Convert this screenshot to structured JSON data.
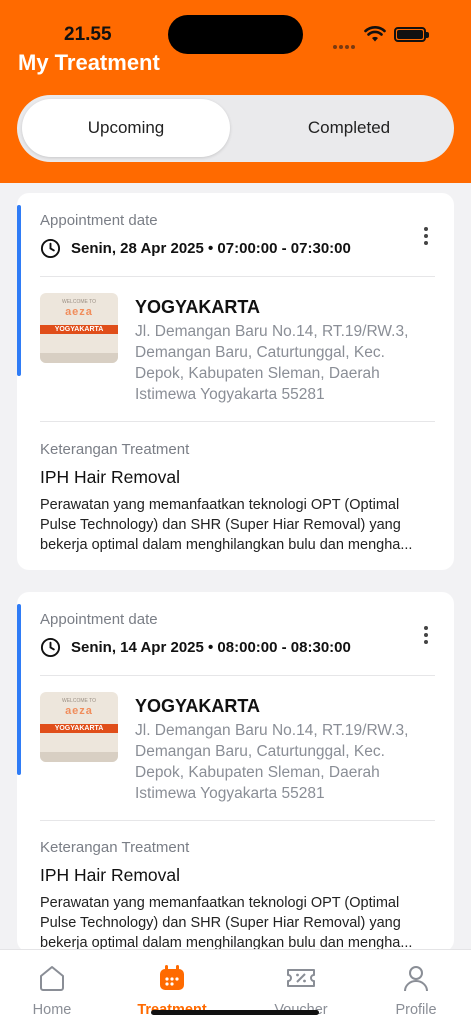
{
  "status_bar": {
    "time": "21.55"
  },
  "header": {
    "title": "My Treatment"
  },
  "tabs": {
    "upcoming": "Upcoming",
    "completed": "Completed"
  },
  "appointments": [
    {
      "date_label": "Appointment date",
      "datetime": "Senin, 28 Apr 2025 • 07:00:00 - 07:30:00",
      "clinic_city": "YOGYAKARTA",
      "clinic_address": "Jl. Demangan Baru No.14, RT.19/RW.3, Demangan Baru, Caturtunggal, Kec. Depok, Kabupaten Sleman, Daerah Istimewa Yogyakarta 55281",
      "thumb": {
        "welcome": "WELCOME TO",
        "brand": "aeza",
        "city": "YOGYAKARTA"
      },
      "treatment_label": "Keterangan Treatment",
      "treatment_name": "IPH Hair Removal",
      "treatment_desc": "Perawatan yang memanfaatkan teknologi OPT (Optimal Pulse Technology) dan SHR (Super Hiar Removal) yang bekerja optimal dalam menghilangkan bulu dan mengha..."
    },
    {
      "date_label": "Appointment date",
      "datetime": "Senin, 14 Apr 2025 • 08:00:00 - 08:30:00",
      "clinic_city": "YOGYAKARTA",
      "clinic_address": "Jl. Demangan Baru No.14, RT.19/RW.3, Demangan Baru, Caturtunggal, Kec. Depok, Kabupaten Sleman, Daerah Istimewa Yogyakarta 55281",
      "thumb": {
        "welcome": "WELCOME TO",
        "brand": "aeza",
        "city": "YOGYAKARTA"
      },
      "treatment_label": "Keterangan Treatment",
      "treatment_name": "IPH Hair Removal",
      "treatment_desc": "Perawatan yang memanfaatkan teknologi OPT (Optimal Pulse Technology) dan SHR (Super Hiar Removal) yang bekerja optimal dalam menghilangkan bulu dan mengha..."
    }
  ],
  "nav": [
    {
      "label": "Home",
      "icon": "home-icon"
    },
    {
      "label": "Treatment",
      "icon": "calendar-icon",
      "active": true
    },
    {
      "label": "Voucher",
      "icon": "voucher-icon"
    },
    {
      "label": "Profile",
      "icon": "person-icon"
    }
  ],
  "colors": {
    "brand": "#ff6a00",
    "accent": "#2f7cf6"
  }
}
